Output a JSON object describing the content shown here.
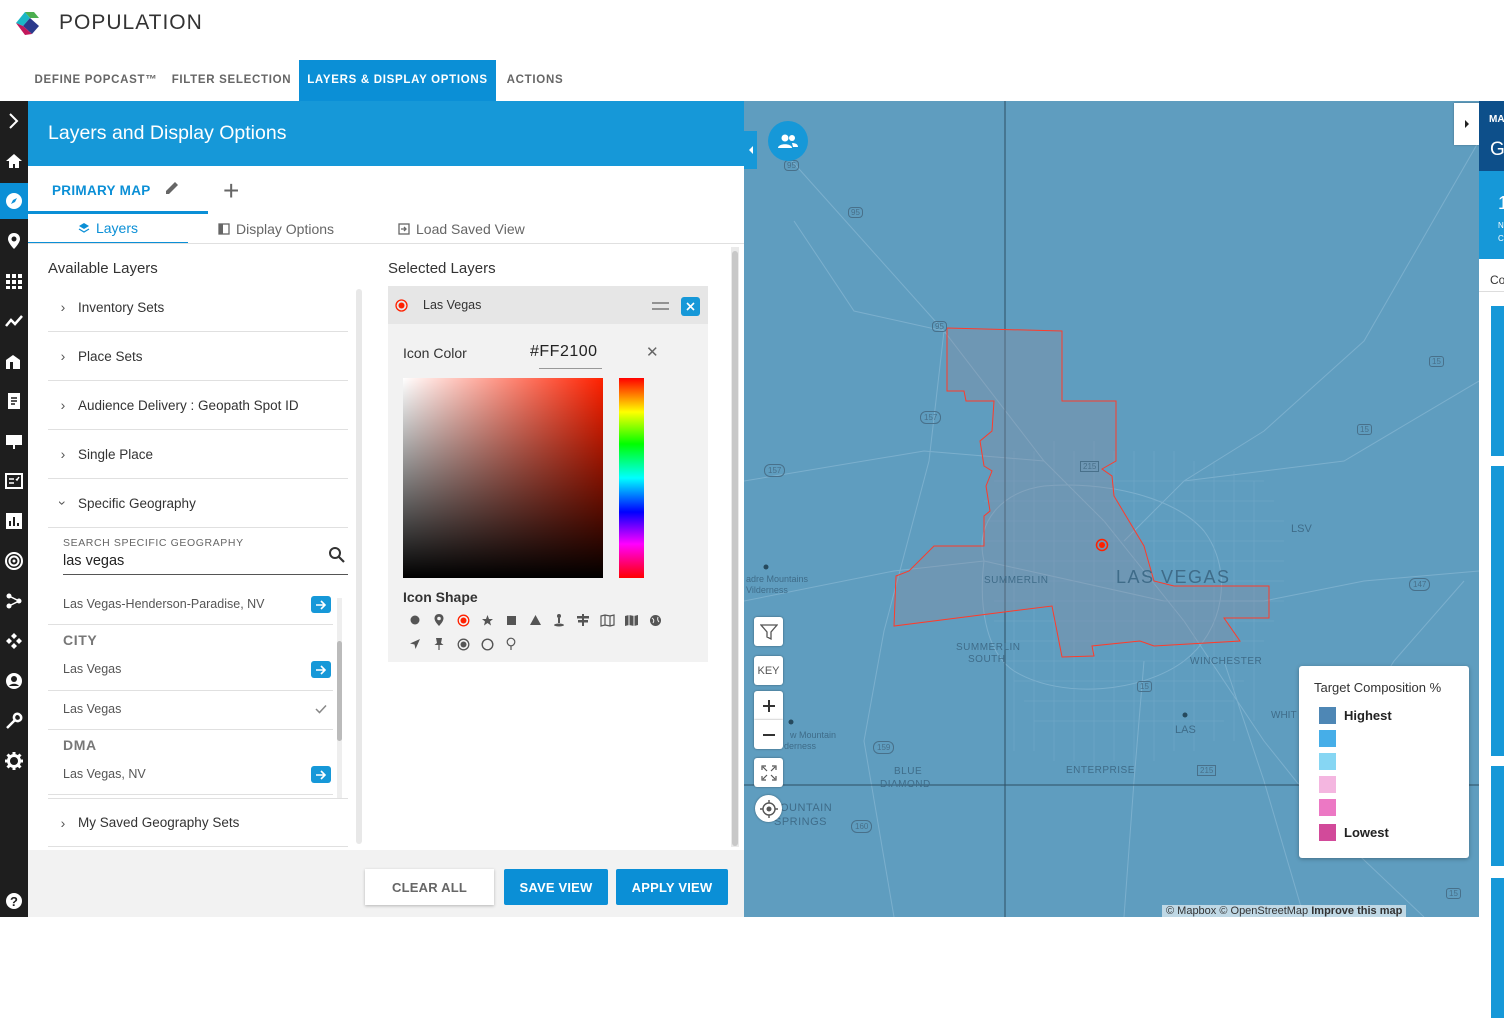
{
  "app": {
    "title": "POPULATION"
  },
  "nav": {
    "tabs": [
      {
        "label": "DEFINE POPCAST™"
      },
      {
        "label": "FILTER SELECTION"
      },
      {
        "label": "LAYERS & DISPLAY OPTIONS"
      },
      {
        "label": "ACTIONS"
      }
    ]
  },
  "panel": {
    "title": "Layers and Display Options",
    "map_tab": "PRIMARY MAP",
    "subtabs": [
      {
        "label": "Layers"
      },
      {
        "label": "Display Options"
      },
      {
        "label": "Load Saved View"
      }
    ],
    "available_title": "Available Layers",
    "selected_title": "Selected Layers",
    "layers": [
      {
        "label": "Inventory Sets"
      },
      {
        "label": "Place Sets"
      },
      {
        "label": "Audience Delivery : Geopath Spot ID"
      },
      {
        "label": "Single Place"
      },
      {
        "label": "Specific Geography"
      },
      {
        "label": "My Saved Geography Sets"
      }
    ],
    "search": {
      "label": "SEARCH SPECIFIC GEOGRAPHY",
      "value": "las vegas"
    },
    "results": {
      "top": "Las Vegas-Henderson-Paradise, NV",
      "city_header": "CITY",
      "city_items": [
        "Las Vegas",
        "Las Vegas"
      ],
      "dma_header": "DMA",
      "dma_items": [
        "Las Vegas, NV"
      ]
    },
    "selected_layer": {
      "name": "Las Vegas",
      "icon_color_label": "Icon Color",
      "icon_color_value": "#FF2100",
      "icon_shape_label": "Icon Shape"
    },
    "buttons": {
      "clear": "CLEAR ALL",
      "save": "SAVE VIEW",
      "apply": "APPLY VIEW"
    }
  },
  "map": {
    "labels": {
      "las_vegas": "LAS VEGAS",
      "summerlin": "SUMMERLIN",
      "summerlin_south_1": "SUMMERLIN",
      "summerlin_south_2": "SOUTH",
      "winchester": "WINCHESTER",
      "enterprise": "ENTERPRISE",
      "blue_diamond_1": "BLUE",
      "blue_diamond_2": "DIAMOND",
      "mountain_springs_1": "OUNTAIN",
      "mountain_springs_2": "SPRINGS",
      "lsv": "LSV",
      "las": "LAS",
      "whit": "WHIT",
      "red_rock_1": "adre Mountains",
      "red_rock_2": "Vilderness",
      "mtn_wild_1": "w Mountain",
      "mtn_wild_2": "derness"
    },
    "shields": [
      "95",
      "95",
      "95",
      "157",
      "157",
      "215",
      "15",
      "15",
      "15",
      "15",
      "147",
      "159",
      "160",
      "215"
    ],
    "key_button": "KEY",
    "legend": {
      "title": "Target Composition %",
      "items": [
        {
          "label": "Highest",
          "color": "#4e87b5"
        },
        {
          "label": "",
          "color": "#46aee8"
        },
        {
          "label": "",
          "color": "#86d6f3"
        },
        {
          "label": "",
          "color": "#f4b6e0"
        },
        {
          "label": "",
          "color": "#ec78c4"
        },
        {
          "label": "Lowest",
          "color": "#d24a9a"
        }
      ]
    },
    "attribution": "© Mapbox © OpenStreetMap",
    "improve": "Improve this map",
    "right_panel": {
      "top": "MA",
      "big": "G",
      "side": "Co",
      "c": "C",
      "n": "N",
      "num": "1"
    }
  },
  "colors": {
    "accent": "#0b8fd6",
    "header": "#1698d8",
    "sidebar": "#1e1e1e",
    "boundary": "#ff2100",
    "map": "#5f9dbf"
  }
}
